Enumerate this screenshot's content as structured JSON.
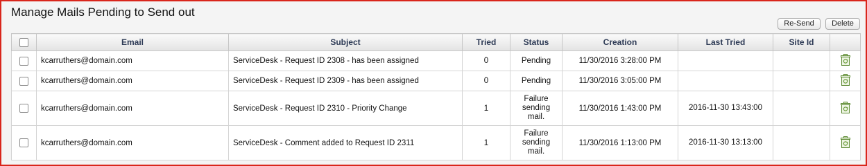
{
  "page": {
    "title": "Manage Mails Pending to Send out"
  },
  "toolbar": {
    "resend_label": "Re-Send",
    "delete_label": "Delete"
  },
  "table": {
    "headers": {
      "email": "Email",
      "subject": "Subject",
      "tried": "Tried",
      "status": "Status",
      "creation": "Creation",
      "last_tried": "Last Tried",
      "site_id": "Site Id"
    },
    "rows": [
      {
        "email": "kcarruthers@domain.com",
        "subject": "ServiceDesk - Request ID 2308 - has been assigned",
        "tried": "0",
        "status": "Pending",
        "creation": "11/30/2016 3:28:00 PM",
        "last_tried": "",
        "site_id": ""
      },
      {
        "email": "kcarruthers@domain.com",
        "subject": "ServiceDesk - Request ID 2309 - has been assigned",
        "tried": "0",
        "status": "Pending",
        "creation": "11/30/2016 3:05:00 PM",
        "last_tried": "",
        "site_id": ""
      },
      {
        "email": "kcarruthers@domain.com",
        "subject": "ServiceDesk - Request ID 2310 - Priority Change",
        "tried": "1",
        "status": "Failure sending mail.",
        "creation": "11/30/2016 1:43:00 PM",
        "last_tried": "2016-11-30 13:43:00",
        "site_id": ""
      },
      {
        "email": "kcarruthers@domain.com",
        "subject": "ServiceDesk - Comment added to Request ID 2311",
        "tried": "1",
        "status": "Failure sending mail.",
        "creation": "11/30/2016 1:13:00 PM",
        "last_tried": "2016-11-30 13:13:00",
        "site_id": ""
      }
    ]
  },
  "icons": {
    "row_action": "recycle-bin-icon",
    "select": "checkbox"
  },
  "colors": {
    "frame_border": "#d9261c",
    "header_text": "#2d3a55",
    "icon_green": "#6a9a3a"
  }
}
